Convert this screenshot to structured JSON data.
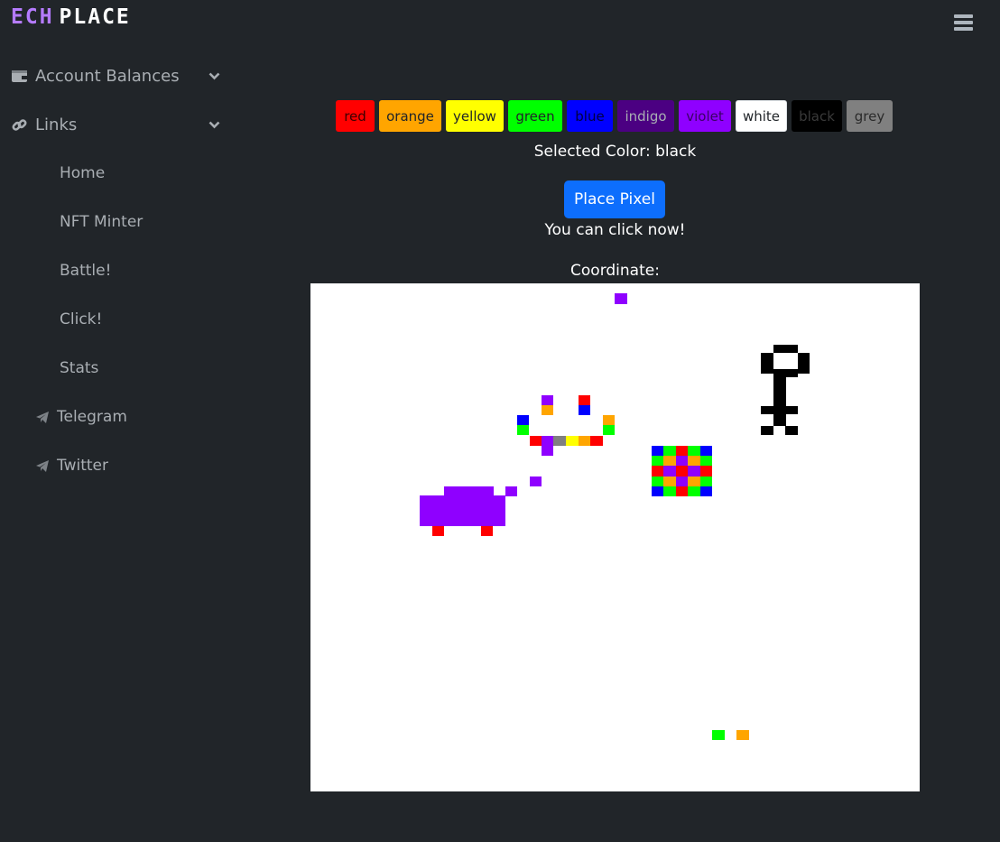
{
  "brand": {
    "part1": "ECH",
    "part2": "PLACE"
  },
  "sidebar": {
    "sections": [
      {
        "label": "Account Balances",
        "icon": "wallet-icon"
      },
      {
        "label": "Links",
        "icon": "link-icon"
      }
    ],
    "links": [
      {
        "label": "Home"
      },
      {
        "label": "NFT Minter"
      },
      {
        "label": "Battle!"
      },
      {
        "label": "Click!"
      },
      {
        "label": "Stats"
      }
    ],
    "external": [
      {
        "label": "Telegram",
        "icon": "telegram-icon"
      },
      {
        "label": "Twitter",
        "icon": "telegram-icon"
      }
    ]
  },
  "palette": [
    {
      "label": "red",
      "color": "#ff0000",
      "text": "#3b0000"
    },
    {
      "label": "orange",
      "color": "#ffa500",
      "text": "#212529"
    },
    {
      "label": "yellow",
      "color": "#ffff00",
      "text": "#212529"
    },
    {
      "label": "green",
      "color": "#00ff00",
      "text": "#212529"
    },
    {
      "label": "blue",
      "color": "#0000ff",
      "text": "#000040"
    },
    {
      "label": "indigo",
      "color": "#4b0082",
      "text": "#a9aeb3"
    },
    {
      "label": "violet",
      "color": "#8f00ff",
      "text": "#3a0066"
    },
    {
      "label": "white",
      "color": "#ffffff",
      "text": "#212529"
    },
    {
      "label": "black",
      "color": "#000000",
      "text": "#3a3a3a"
    },
    {
      "label": "grey",
      "color": "#808080",
      "text": "#2a2a2a"
    }
  ],
  "selected": {
    "prefix": "Selected Color:",
    "value": "black"
  },
  "place_button": {
    "label": "Place Pixel"
  },
  "click_status": "You can click now!",
  "coordinate": {
    "label": "Coordinate:"
  },
  "canvas_colors": {
    "V": "#8f00ff",
    "R": "#ff0000",
    "O": "#ffa500",
    "Y": "#ffff00",
    "G": "#00ff00",
    "B": "#0000ff",
    "K": "#000000",
    "A": "#808080"
  }
}
